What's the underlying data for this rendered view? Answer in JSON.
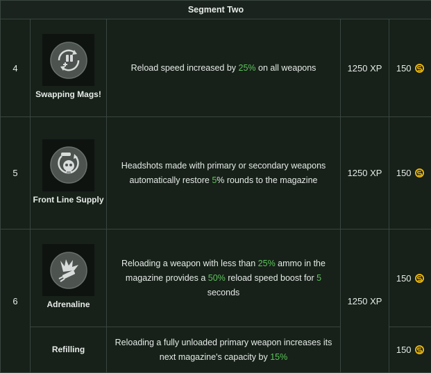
{
  "header": {
    "title": "Segment Two"
  },
  "rows": [
    {
      "number": "4",
      "perk_name": "Swapping Mags!",
      "desc_parts": [
        "Reload speed increased by ",
        "25%",
        " on all weapons"
      ],
      "xp": "1250 XP",
      "coins": "150",
      "icon": "swap-mags-icon"
    },
    {
      "number": "5",
      "perk_name": "Front Line Supply",
      "desc_parts": [
        "Headshots made with primary or secondary weapons automatically restore ",
        "5",
        "% rounds to the magazine"
      ],
      "xp": "1250 XP",
      "coins": "150",
      "icon": "skull-ammo-icon"
    },
    {
      "number": "6",
      "perk_name": "Adrenaline",
      "desc_parts": [
        "Reloading a weapon with less than ",
        "25%",
        " ammo in the magazine provides a ",
        "50%",
        " reload speed boost for ",
        "5",
        " seconds"
      ],
      "xp": "1250 XP",
      "coins": "150",
      "icon": "adrenaline-icon"
    },
    {
      "perk_name": "Refilling",
      "desc_parts": [
        "Reloading a fully unloaded primary weapon increases its next magazine's capacity by ",
        "15%"
      ],
      "coins": "150"
    }
  ],
  "colors": {
    "highlight": "#5cc65a",
    "coin": "#f0b90b",
    "border": "#3a4640",
    "background": "#172019"
  }
}
